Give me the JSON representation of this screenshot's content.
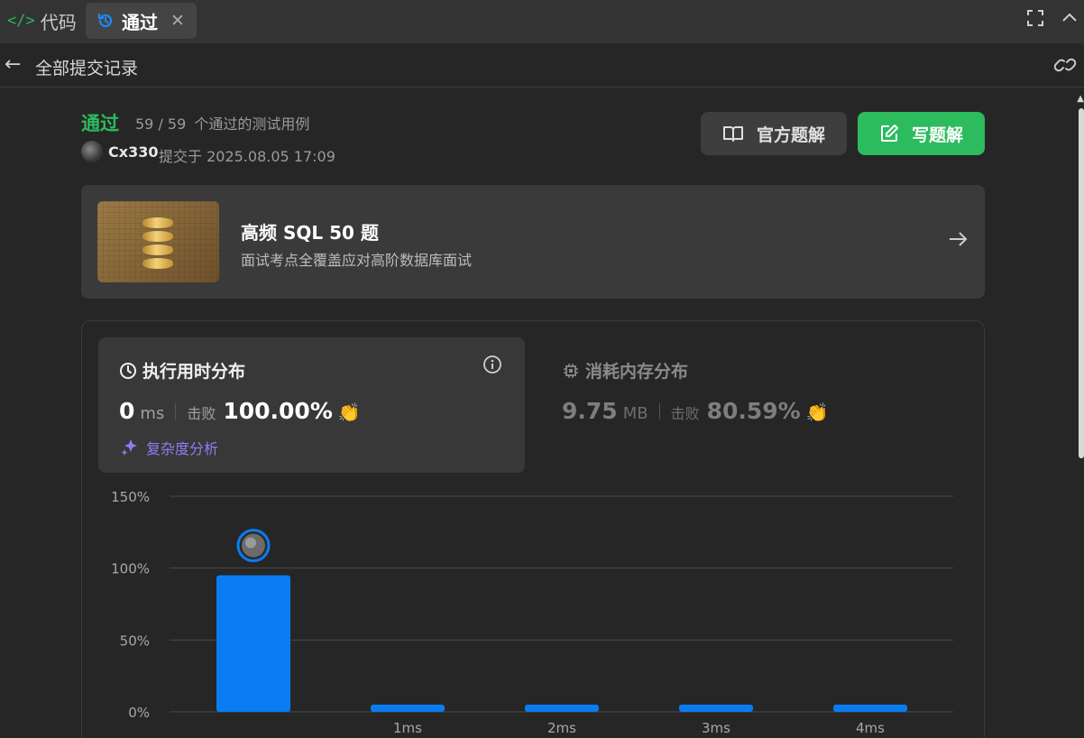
{
  "tabs": [
    {
      "icon": "code-icon",
      "label": "代码"
    },
    {
      "icon": "history-icon",
      "label": "通过"
    }
  ],
  "header": {
    "back_label": "全部提交记录"
  },
  "submission": {
    "status": "通过",
    "passed": "59 / 59",
    "cases_label": "个通过的测试用例",
    "username": "Cx330",
    "submitted_at": "提交于 2025.08.05 17:09"
  },
  "buttons": {
    "official": "官方题解",
    "write": "写题解"
  },
  "promo": {
    "title": "高频 SQL 50 题",
    "desc": "面试考点全覆盖应对高阶数据库面试"
  },
  "runtime": {
    "title": "执行用时分布",
    "value": "0",
    "unit": "ms",
    "beat_label": "击败",
    "beat_pct": "100.00%"
  },
  "memory": {
    "title": "消耗内存分布",
    "value": "9.75",
    "unit": "MB",
    "beat_label": "击败",
    "beat_pct": "80.59%"
  },
  "complexity_label": "复杂度分析",
  "colors": {
    "accent_green": "#2cbb5d",
    "bar_blue": "#0a7cf2",
    "purple": "#8f7df5"
  },
  "chart_data": {
    "type": "bar",
    "categories": [
      "",
      "1ms",
      "2ms",
      "3ms",
      "4ms"
    ],
    "values": [
      95,
      5,
      5,
      5,
      5
    ],
    "yticks": [
      "0%",
      "50%",
      "100%",
      "150%"
    ],
    "ylim": [
      0,
      150
    ],
    "grid": true,
    "user_marker_category": 0
  }
}
